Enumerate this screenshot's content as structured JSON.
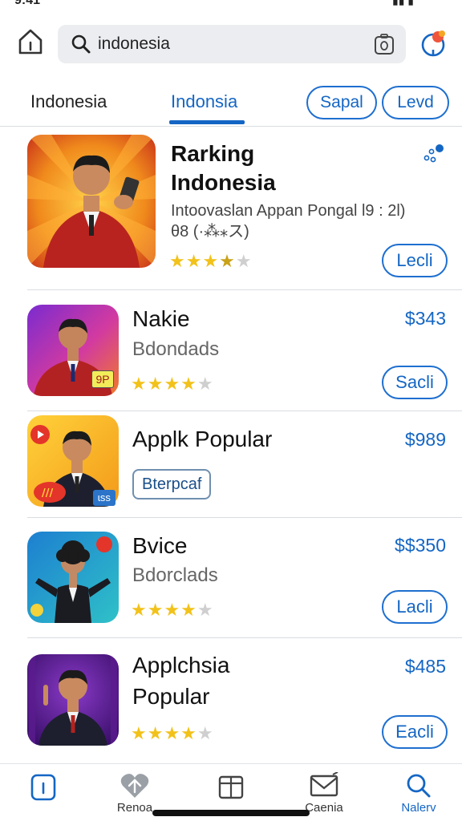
{
  "status": {
    "time": "9:41",
    "indicators": "▮▮ ▮"
  },
  "header": {
    "search_query": "indonesia",
    "icons": [
      "home-icon",
      "search-icon",
      "camera-icon",
      "profile-icon"
    ]
  },
  "tabs": [
    {
      "label": "Indonesia",
      "active": false
    },
    {
      "label": "Indonsia",
      "active": true
    }
  ],
  "filter_pills": [
    {
      "label": "Sapal"
    },
    {
      "label": "Levd"
    }
  ],
  "featured": {
    "title_line1": "Rarking",
    "title_line2": "Indonesia",
    "desc_line1": "Intoovaslan Appan Pongal l9 : 2l)",
    "desc_line2": "θ8 (·⁂⁎ス)",
    "rating": 3.5,
    "button": "Lecli"
  },
  "apps": [
    {
      "title": "Nakie",
      "subtitle": "Bdondads",
      "price": "$343",
      "rating": 4,
      "button": "Sacli",
      "badge": "9P"
    },
    {
      "title": "Applk Popular",
      "tag": "Bterpcaf",
      "price": "$989",
      "badge": "ɩss"
    },
    {
      "title": "Bvice",
      "subtitle": "Bdorclads",
      "price": "$$350",
      "rating": 4,
      "button": "Lacli"
    },
    {
      "title_line1": "Applchsia",
      "title_line2": "Popular",
      "price": "$485",
      "rating": 4,
      "button": "Eacli"
    }
  ],
  "bottom_nav": [
    {
      "label": "",
      "icon": "home-icon",
      "active": false
    },
    {
      "label": "Renoa",
      "icon": "heart-icon",
      "active": false
    },
    {
      "label": "",
      "icon": "box-icon",
      "active": false
    },
    {
      "label": "Caenia",
      "icon": "mail-icon",
      "active": false
    },
    {
      "label": "Nalerv",
      "icon": "search-icon",
      "active": true
    }
  ],
  "colors": {
    "accent": "#1466c4",
    "star": "#f2c21b",
    "search_bg": "#ebedf0"
  }
}
